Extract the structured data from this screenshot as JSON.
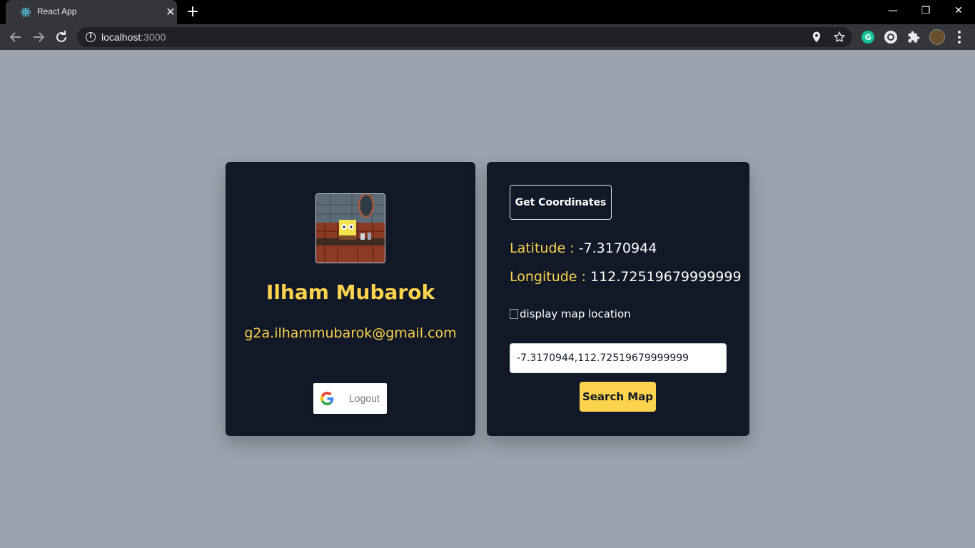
{
  "browser": {
    "tab_title": "React App",
    "tab_close": "✕",
    "new_tab": "+",
    "url_host": "localhost",
    "url_port": ":3000",
    "window_minimize": "—",
    "window_restore": "❐",
    "window_close": "✕"
  },
  "profile": {
    "name": "Ilham Mubarok",
    "email": "g2a.ilhammubarok@gmail.com",
    "logout_label": "Logout"
  },
  "location": {
    "get_coordinates_label": "Get Coordinates",
    "latitude_label": "Latitude : ",
    "latitude_value": "-7.3170944",
    "longitude_label": "Longitude : ",
    "longitude_value": "112.72519679999999",
    "map_alt": "display map location",
    "search_value": "-7.3170944,112.72519679999999",
    "search_button_label": "Search Map"
  },
  "colors": {
    "page_bg": "#9ca3af",
    "card_bg": "#111827",
    "accent": "#fcd34d"
  }
}
